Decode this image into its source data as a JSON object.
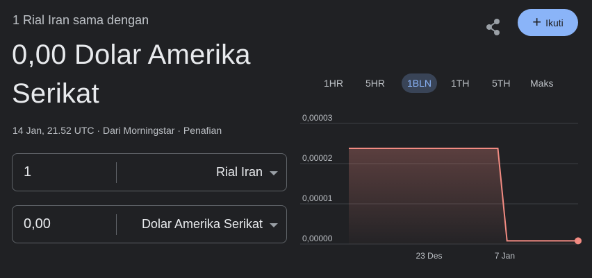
{
  "header": {
    "subtitle": "1 Rial Iran sama dengan",
    "value": "0,00 Dolar Amerika Serikat",
    "meta_time": "14 Jan, 21.52 UTC",
    "meta_sep": " · ",
    "meta_source": "Dari Morningstar",
    "meta_disclaimer": "Penafian"
  },
  "actions": {
    "follow_label": "Ikuti",
    "share_icon": "share-icon",
    "plus_icon": "plus-icon"
  },
  "converter": {
    "from": {
      "amount": "1",
      "currency": "Rial Iran"
    },
    "to": {
      "amount": "0,00",
      "currency": "Dolar Amerika Serikat"
    }
  },
  "tabs": [
    "1HR",
    "5HR",
    "1BLN",
    "1TH",
    "5TH",
    "Maks"
  ],
  "active_tab": "1BLN",
  "colors": {
    "accent": "#8ab4f8",
    "line": "#f28b82",
    "background": "#202124"
  },
  "chart_data": {
    "type": "area",
    "y_ticks": [
      "0,00003",
      "0,00002",
      "0,00001",
      "0,00000"
    ],
    "ylim": [
      0,
      3e-05
    ],
    "x_ticks": [
      {
        "label": "23 Des",
        "x": 0.35
      },
      {
        "label": "7 Jan",
        "x": 0.68
      }
    ],
    "series": [
      {
        "x": [
          0,
          0.65,
          0.69,
          1
        ],
        "values": [
          2.38e-05,
          2.38e-05,
          8e-07,
          8e-07
        ]
      }
    ],
    "grid": true
  }
}
